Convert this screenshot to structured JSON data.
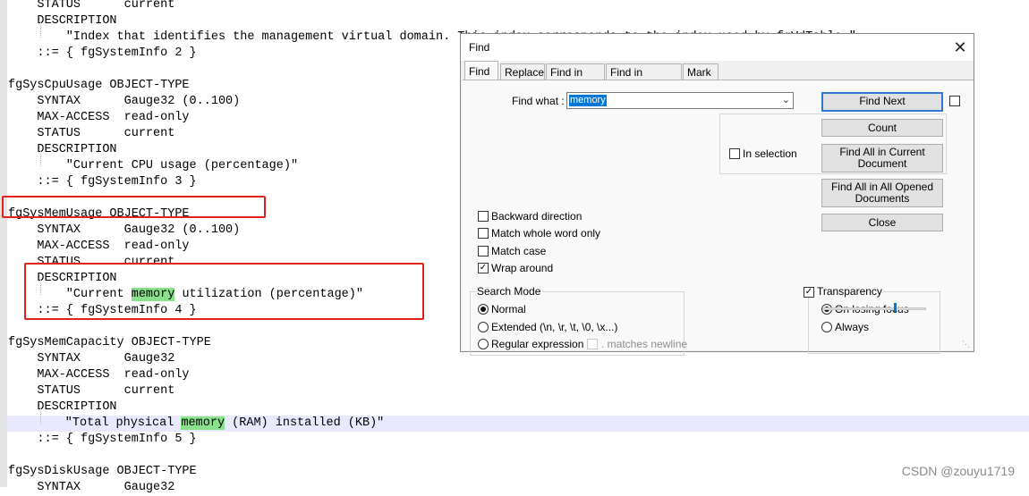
{
  "editor": {
    "lines": [
      {
        "text": "    STATUS      current"
      },
      {
        "text": "    DESCRIPTION"
      },
      {
        "text": "        \"Index that identifies the management virtual domain. This index corresponds to the index used by fgVdTable.\""
      },
      {
        "text": "    ::= { fgSystemInfo 2 }"
      },
      {
        "text": ""
      },
      {
        "text": "fgSysCpuUsage OBJECT-TYPE"
      },
      {
        "text": "    SYNTAX      Gauge32 (0..100)"
      },
      {
        "text": "    MAX-ACCESS  read-only"
      },
      {
        "text": "    STATUS      current"
      },
      {
        "text": "    DESCRIPTION"
      },
      {
        "text": "        \"Current CPU usage (percentage)\""
      },
      {
        "text": "    ::= { fgSystemInfo 3 }"
      },
      {
        "text": ""
      },
      {
        "text": "fgSysMemUsage OBJECT-TYPE"
      },
      {
        "text": "    SYNTAX      Gauge32 (0..100)"
      },
      {
        "text": "    MAX-ACCESS  read-only"
      },
      {
        "text": "    STATUS      current"
      },
      {
        "text": "    DESCRIPTION"
      },
      {
        "pre": "        \"Current ",
        "match": "memory",
        "post": " utilization (percentage)\""
      },
      {
        "text": "    ::= { fgSystemInfo 4 }"
      },
      {
        "text": ""
      },
      {
        "text": "fgSysMemCapacity OBJECT-TYPE"
      },
      {
        "text": "    SYNTAX      Gauge32"
      },
      {
        "text": "    MAX-ACCESS  read-only"
      },
      {
        "text": "    STATUS      current"
      },
      {
        "text": "    DESCRIPTION"
      },
      {
        "pre": "        \"Total physical ",
        "match": "memory",
        "post": " (RAM) installed (KB)\""
      },
      {
        "text": "    ::= { fgSystemInfo 5 }"
      },
      {
        "text": ""
      },
      {
        "text": "fgSysDiskUsage OBJECT-TYPE"
      },
      {
        "text": "    SYNTAX      Gauge32"
      }
    ],
    "current_line_index": 26,
    "highlight_color": "#8be08b",
    "annotation_color": "#e0241b"
  },
  "watermark": "CSDN @zouyu1719",
  "find_dialog": {
    "title": "Find",
    "close_glyph": "✕",
    "tabs": [
      "Find",
      "Replace",
      "Find in Files",
      "Find in Projects",
      "Mark"
    ],
    "active_tab": "Find",
    "find_what_label": "Find what :",
    "find_what_value": "memory",
    "buttons": {
      "find_next": "Find Next",
      "count": "Count",
      "find_all_current_1": "Find All in Current",
      "find_all_current_2": "Document",
      "find_all_opened_1": "Find All in All Opened",
      "find_all_opened_2": "Documents",
      "close": "Close"
    },
    "in_selection": {
      "label": "In selection",
      "checked": false
    },
    "options": [
      {
        "label": "Backward direction",
        "checked": false
      },
      {
        "label": "Match whole word only",
        "checked": false
      },
      {
        "label": "Match case",
        "checked": false
      },
      {
        "label": "Wrap around",
        "checked": true
      }
    ],
    "search_mode": {
      "title": "Search Mode",
      "options": [
        {
          "label": "Normal",
          "selected": true
        },
        {
          "label": "Extended (\\n, \\r, \\t, \\0, \\x...)",
          "selected": false
        },
        {
          "label": "Regular expression",
          "selected": false
        }
      ],
      "matches_newline": {
        "label": ". matches newline",
        "checked": false,
        "enabled": false
      }
    },
    "transparency": {
      "label": "Transparency",
      "checked": true,
      "options": [
        {
          "label": "On losing focus",
          "selected": true
        },
        {
          "label": "Always",
          "selected": false
        }
      ],
      "slider_level": 0.71
    }
  }
}
